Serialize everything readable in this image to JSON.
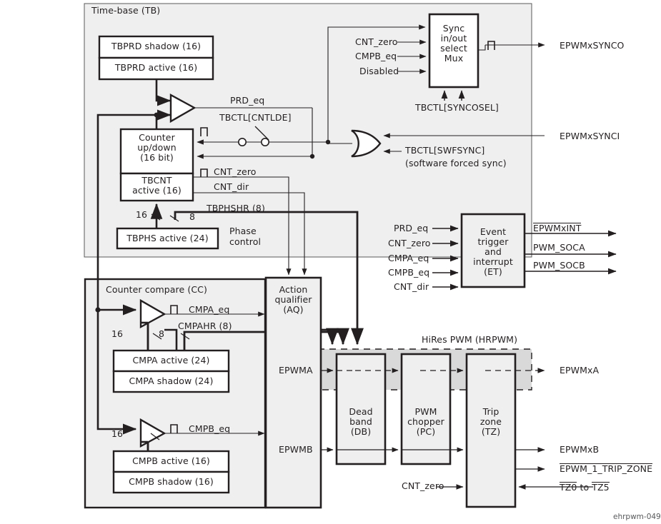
{
  "diagram": {
    "title_footer": "ehrpwm-049",
    "colors": {
      "module_fill": "#efefef",
      "block_fill": "#efefef",
      "hires_band": "#d9d9d9",
      "stroke": "#231f20",
      "white": "#ffffff"
    }
  },
  "modules": {
    "time_base": {
      "label": "Time-base (TB)"
    },
    "counter_compare": {
      "label": "Counter compare (CC)"
    },
    "hires": {
      "label": "HiRes PWM (HRPWM)"
    }
  },
  "blocks": {
    "tbprd_shadow": {
      "label": "TBPRD shadow (16)"
    },
    "tbprd_active": {
      "label": "TBPRD active (16)"
    },
    "counter": {
      "line1": "Counter",
      "line2": "up/down",
      "line3": "(16 bit)"
    },
    "tbcnt_active": {
      "line1": "TBCNT",
      "line2": "active (16)"
    },
    "tbphs_active": {
      "label": "TBPHS active (24)"
    },
    "sync_mux": {
      "line1": "Sync",
      "line2": "in/out",
      "line3": "select",
      "line4": "Mux"
    },
    "event_trigger": {
      "line1": "Event",
      "line2": "trigger",
      "line3": "and",
      "line4": "interrupt",
      "line5": "(ET)"
    },
    "action_qualifier": {
      "line1": "Action",
      "line2": "qualifier",
      "line3": "(AQ)"
    },
    "dead_band": {
      "line1": "Dead",
      "line2": "band",
      "line3": "(DB)"
    },
    "pwm_chopper": {
      "line1": "PWM",
      "line2": "chopper",
      "line3": "(PC)"
    },
    "trip_zone": {
      "line1": "Trip",
      "line2": "zone",
      "line3": "(TZ)"
    },
    "cmpa_active": {
      "label": "CMPA active (24)"
    },
    "cmpa_shadow": {
      "label": "CMPA shadow (24)"
    },
    "cmpb_active": {
      "label": "CMPB active (16)"
    },
    "cmpb_shadow": {
      "label": "CMPB shadow (16)"
    }
  },
  "signals": {
    "prd_eq": "PRD_eq",
    "cnt_zero": "CNT_zero",
    "cnt_dir": "CNT_dir",
    "cmpa_eq": "CMPA_eq",
    "cmpb_eq": "CMPB_eq",
    "cmpahr": "CMPAHR (8)",
    "tbphshr": "TBPHSHR (8)",
    "phase_control_l1": "Phase",
    "phase_control_l2": "control",
    "epwma": "EPWMA",
    "epwmb": "EPWMB",
    "width16_a": "16",
    "width8_a": "8",
    "width16_b": "16",
    "width8_b": "8",
    "width16_c": "16"
  },
  "mux_inputs": {
    "cnt_zero": "CNT_zero",
    "cmpb_eq": "CMPB_eq",
    "disabled": "Disabled"
  },
  "et_inputs": {
    "prd_eq": "PRD_eq",
    "cnt_zero": "CNT_zero",
    "cmpa_eq": "CMPA_eq",
    "cmpb_eq": "CMPB_eq",
    "cnt_dir": "CNT_dir"
  },
  "et_outputs": {
    "epwmxint": "EPWMxINT",
    "pwm_soca": "PWM_SOCA",
    "pwm_socb": "PWM_SOCB"
  },
  "controls": {
    "syncosel": "TBCTL[SYNCOSEL]",
    "cntlde": "TBCTL[CNTLDE]",
    "swfsync": "TBCTL[SWFSYNC]",
    "swfsync_note": "(software forced sync)"
  },
  "io": {
    "epwmxsynco": "EPWMxSYNCO",
    "epwmxsynci": "EPWMxSYNCI",
    "epwmxa": "EPWMxA",
    "epwmxb": "EPWMxB",
    "epwm_1_trip_zone": "EPWM_1_TRIP_ZONE",
    "tz_range_pre": "TZ0",
    "tz_range_mid": "to",
    "tz_range_post": "TZ5",
    "tz_cnt_zero": "CNT_zero"
  }
}
